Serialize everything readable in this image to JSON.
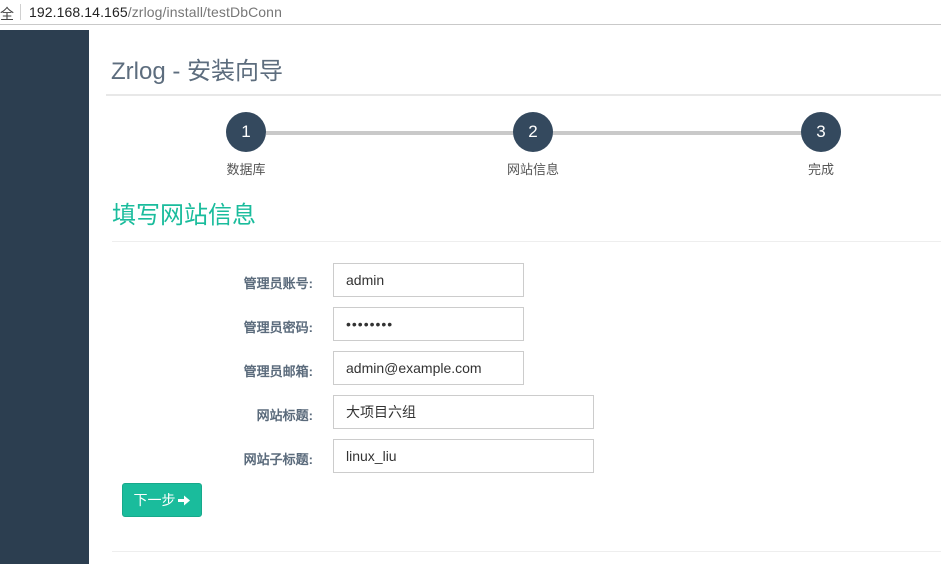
{
  "browser": {
    "security_label": "全",
    "url_host": "192.168.14.165",
    "url_path": "/zrlog/install/testDbConn"
  },
  "header": {
    "title": "Zrlog - 安装向导"
  },
  "steps": [
    {
      "number": "1",
      "label": "数据库"
    },
    {
      "number": "2",
      "label": "网站信息"
    },
    {
      "number": "3",
      "label": "完成"
    }
  ],
  "section": {
    "title": "填写网站信息"
  },
  "form": {
    "admin_account": {
      "label": "管理员账号:",
      "value": "admin"
    },
    "admin_password": {
      "label": "管理员密码:",
      "value": "••••••••"
    },
    "admin_email": {
      "label": "管理员邮箱:",
      "value": "admin@example.com"
    },
    "site_title": {
      "label": "网站标题:",
      "value": "大项目六组"
    },
    "site_subtitle": {
      "label": "网站子标题:",
      "value": "linux_liu"
    }
  },
  "actions": {
    "next_label": "下一步"
  },
  "colors": {
    "sidebar": "#2c3e50",
    "step_circle": "#34495e",
    "accent": "#1abc9c"
  }
}
